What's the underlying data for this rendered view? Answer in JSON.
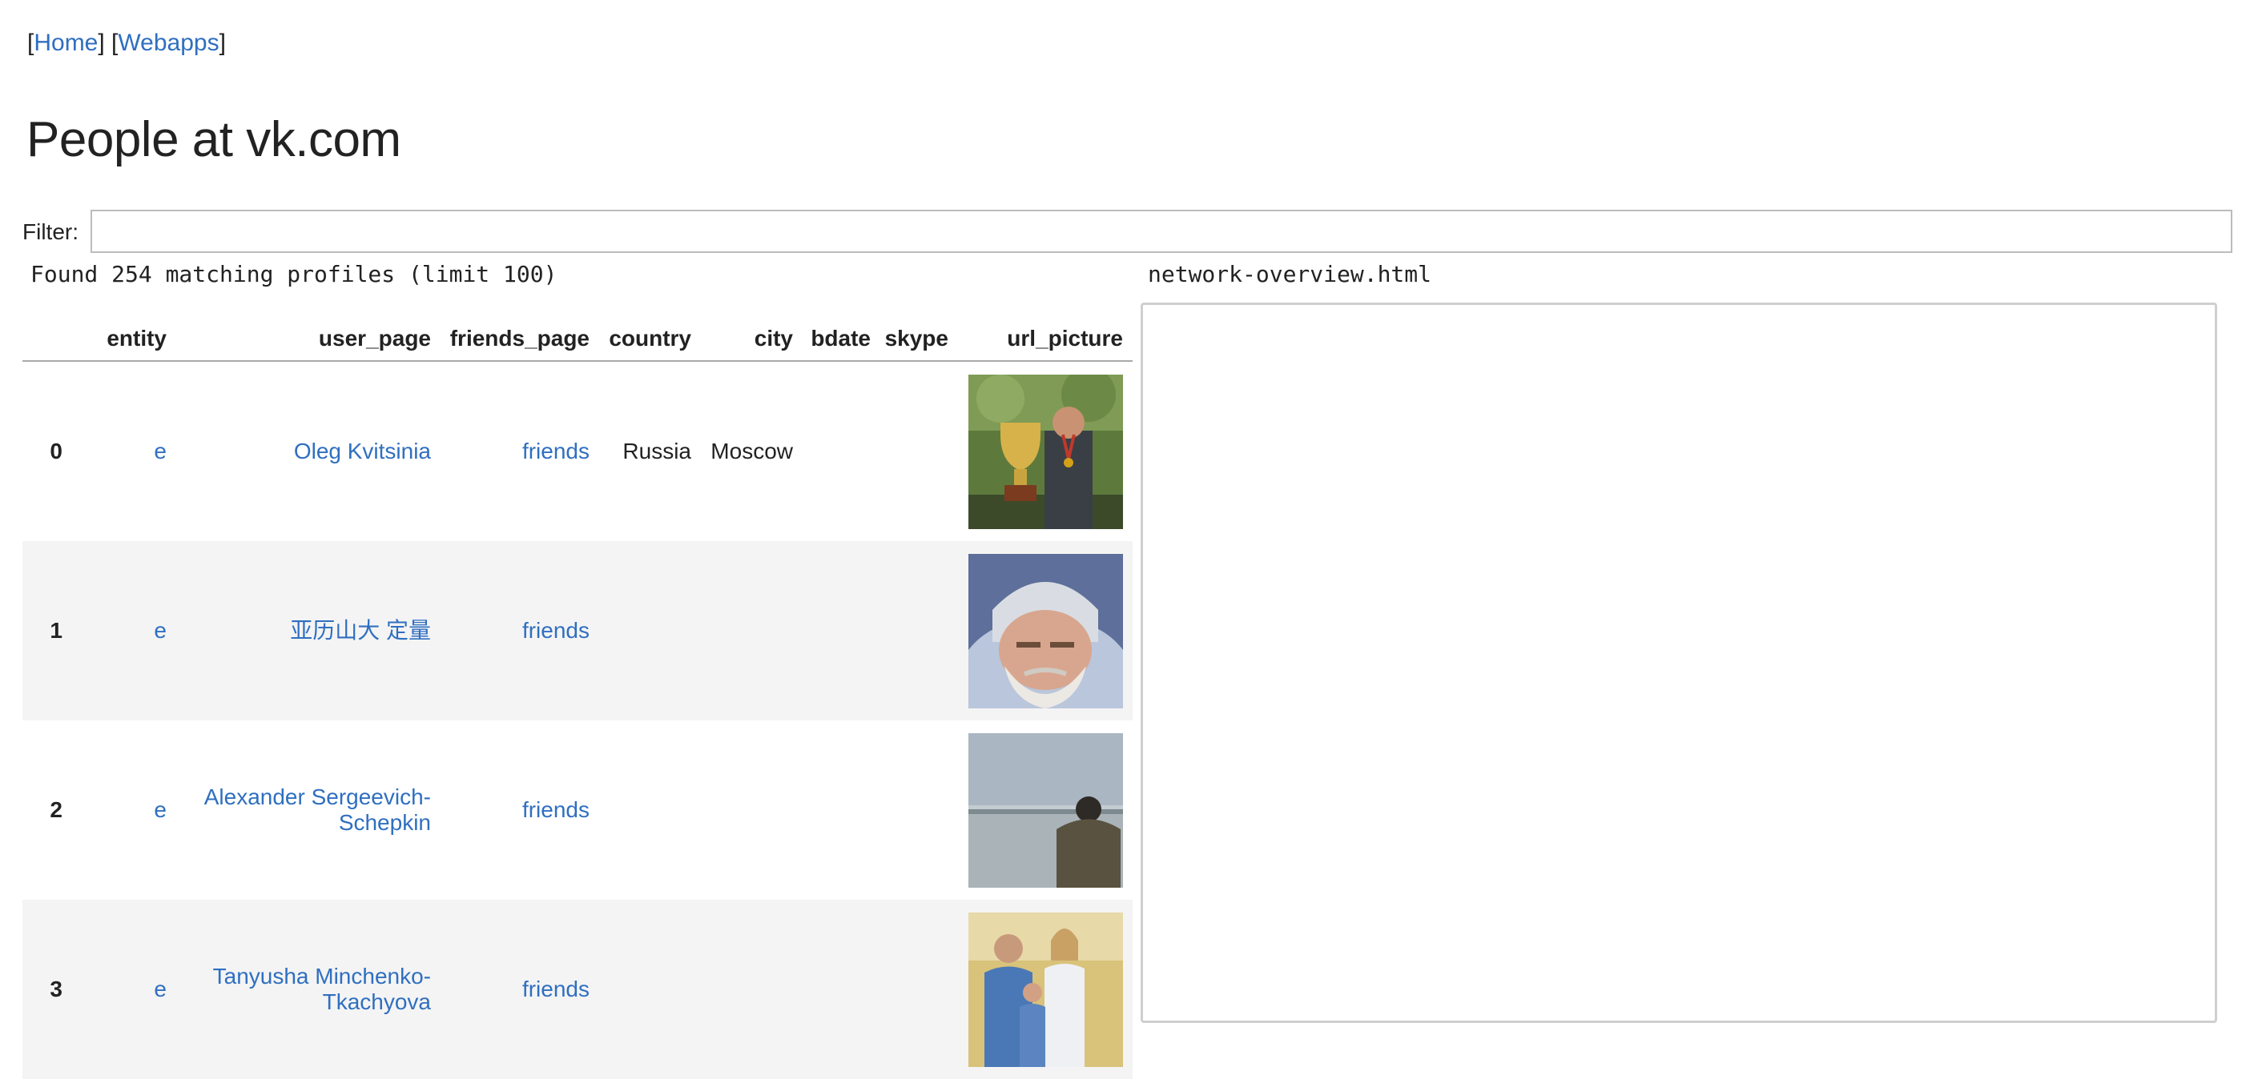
{
  "nav": {
    "home": "Home",
    "webapps": "Webapps"
  },
  "title": "People at vk.com",
  "filter": {
    "label": "Filter:",
    "value": "",
    "placeholder": ""
  },
  "found_text": "Found 254 matching profiles (limit 100)",
  "frame_name": "network-overview.html",
  "columns": [
    "entity",
    "user_page",
    "friends_page",
    "country",
    "city",
    "bdate",
    "skype",
    "url_picture"
  ],
  "rows": [
    {
      "index": "0",
      "entity": "e",
      "user_page": "Oleg Kvitsinia",
      "friends_page": "friends",
      "country": "Russia",
      "city": "Moscow",
      "bdate": "",
      "skype": "",
      "picture_icon": "trophy-portrait-photo"
    },
    {
      "index": "1",
      "entity": "e",
      "user_page": "亚历山大 定量",
      "friends_page": "friends",
      "country": "",
      "city": "",
      "bdate": "",
      "skype": "",
      "picture_icon": "winter-hat-portrait-photo"
    },
    {
      "index": "2",
      "entity": "e",
      "user_page": "Alexander Sergeevich-Schepkin",
      "friends_page": "friends",
      "country": "",
      "city": "",
      "bdate": "",
      "skype": "",
      "picture_icon": "lake-view-photo"
    },
    {
      "index": "3",
      "entity": "e",
      "user_page": "Tanyusha Minchenko-Tkachyova",
      "friends_page": "friends",
      "country": "",
      "city": "",
      "bdate": "",
      "skype": "",
      "picture_icon": "family-photo"
    }
  ]
}
